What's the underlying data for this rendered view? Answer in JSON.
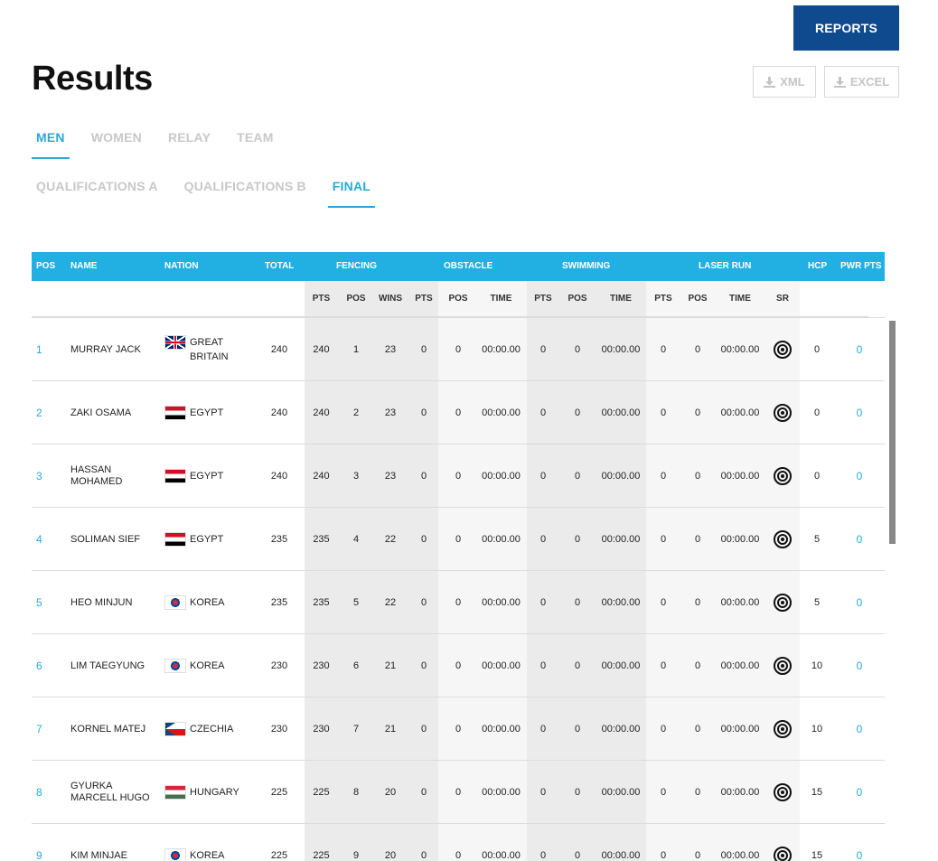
{
  "reports_label": "REPORTS",
  "title": "Results",
  "downloads": {
    "xml": "XML",
    "excel": "EXCEL"
  },
  "gender_tabs": [
    {
      "label": "MEN",
      "active": true
    },
    {
      "label": "WOMEN",
      "active": false
    },
    {
      "label": "RELAY",
      "active": false
    },
    {
      "label": "TEAM",
      "active": false
    }
  ],
  "round_tabs": [
    {
      "label": "QUALIFICATIONS A",
      "active": false
    },
    {
      "label": "QUALIFICATIONS B",
      "active": false
    },
    {
      "label": "FINAL",
      "active": true
    }
  ],
  "header_top": {
    "pos": "POS",
    "name": "NAME",
    "nation": "NATION",
    "total": "TOTAL",
    "fencing": "FENCING",
    "obstacle": "OBSTACLE",
    "swimming": "SWIMMING",
    "laser_run": "LASER RUN",
    "hcp": "HCP",
    "pwr_pts": "PWR PTS"
  },
  "header_sub": {
    "fencing": [
      "PTS",
      "POS",
      "WINS"
    ],
    "obstacle": [
      "PTS",
      "POS",
      "TIME"
    ],
    "swimming": [
      "PTS",
      "POS",
      "TIME"
    ],
    "laser_run": [
      "PTS",
      "POS",
      "TIME",
      "SR"
    ]
  },
  "accent_color": "#22afe2",
  "rows": [
    {
      "pos": "1",
      "name_l1": "MURRAY JACK",
      "name_l2": "",
      "nation_l1": "GREAT",
      "nation_l2": "BRITAIN",
      "flag": "gb",
      "total": "240",
      "f_pts": "240",
      "f_pos": "1",
      "f_wins": "23",
      "o_pts": "0",
      "o_pos": "0",
      "o_time": "00:00.00",
      "s_pts": "0",
      "s_pos": "0",
      "s_time": "00:00.00",
      "l_pts": "0",
      "l_pos": "0",
      "l_time": "00:00.00",
      "sr": "target-icon",
      "hcp": "0",
      "pwr": "0"
    },
    {
      "pos": "2",
      "name_l1": "ZAKI OSAMA",
      "name_l2": "",
      "nation_l1": "EGYPT",
      "nation_l2": "",
      "flag": "eg",
      "total": "240",
      "f_pts": "240",
      "f_pos": "2",
      "f_wins": "23",
      "o_pts": "0",
      "o_pos": "0",
      "o_time": "00:00.00",
      "s_pts": "0",
      "s_pos": "0",
      "s_time": "00:00.00",
      "l_pts": "0",
      "l_pos": "0",
      "l_time": "00:00.00",
      "sr": "target-icon",
      "hcp": "0",
      "pwr": "0"
    },
    {
      "pos": "3",
      "name_l1": "HASSAN",
      "name_l2": "MOHAMED",
      "nation_l1": "EGYPT",
      "nation_l2": "",
      "flag": "eg",
      "total": "240",
      "f_pts": "240",
      "f_pos": "3",
      "f_wins": "23",
      "o_pts": "0",
      "o_pos": "0",
      "o_time": "00:00.00",
      "s_pts": "0",
      "s_pos": "0",
      "s_time": "00:00.00",
      "l_pts": "0",
      "l_pos": "0",
      "l_time": "00:00.00",
      "sr": "target-icon",
      "hcp": "0",
      "pwr": "0"
    },
    {
      "pos": "4",
      "name_l1": "SOLIMAN SIEF",
      "name_l2": "",
      "nation_l1": "EGYPT",
      "nation_l2": "",
      "flag": "eg",
      "total": "235",
      "f_pts": "235",
      "f_pos": "4",
      "f_wins": "22",
      "o_pts": "0",
      "o_pos": "0",
      "o_time": "00:00.00",
      "s_pts": "0",
      "s_pos": "0",
      "s_time": "00:00.00",
      "l_pts": "0",
      "l_pos": "0",
      "l_time": "00:00.00",
      "sr": "target-icon",
      "hcp": "5",
      "pwr": "0"
    },
    {
      "pos": "5",
      "name_l1": "HEO MINJUN",
      "name_l2": "",
      "nation_l1": "KOREA",
      "nation_l2": "",
      "flag": "kr",
      "total": "235",
      "f_pts": "235",
      "f_pos": "5",
      "f_wins": "22",
      "o_pts": "0",
      "o_pos": "0",
      "o_time": "00:00.00",
      "s_pts": "0",
      "s_pos": "0",
      "s_time": "00:00.00",
      "l_pts": "0",
      "l_pos": "0",
      "l_time": "00:00.00",
      "sr": "target-icon",
      "hcp": "5",
      "pwr": "0"
    },
    {
      "pos": "6",
      "name_l1": "LIM TAEGYUNG",
      "name_l2": "",
      "nation_l1": "KOREA",
      "nation_l2": "",
      "flag": "kr",
      "total": "230",
      "f_pts": "230",
      "f_pos": "6",
      "f_wins": "21",
      "o_pts": "0",
      "o_pos": "0",
      "o_time": "00:00.00",
      "s_pts": "0",
      "s_pos": "0",
      "s_time": "00:00.00",
      "l_pts": "0",
      "l_pos": "0",
      "l_time": "00:00.00",
      "sr": "target-icon",
      "hcp": "10",
      "pwr": "0"
    },
    {
      "pos": "7",
      "name_l1": "KORNEL MATEJ",
      "name_l2": "",
      "nation_l1": "CZECHIA",
      "nation_l2": "",
      "flag": "cz",
      "total": "230",
      "f_pts": "230",
      "f_pos": "7",
      "f_wins": "21",
      "o_pts": "0",
      "o_pos": "0",
      "o_time": "00:00.00",
      "s_pts": "0",
      "s_pos": "0",
      "s_time": "00:00.00",
      "l_pts": "0",
      "l_pos": "0",
      "l_time": "00:00.00",
      "sr": "target-icon",
      "hcp": "10",
      "pwr": "0"
    },
    {
      "pos": "8",
      "name_l1": "GYURKA",
      "name_l2": "MARCELL HUGO",
      "nation_l1": "HUNGARY",
      "nation_l2": "",
      "flag": "hu",
      "total": "225",
      "f_pts": "225",
      "f_pos": "8",
      "f_wins": "20",
      "o_pts": "0",
      "o_pos": "0",
      "o_time": "00:00.00",
      "s_pts": "0",
      "s_pos": "0",
      "s_time": "00:00.00",
      "l_pts": "0",
      "l_pos": "0",
      "l_time": "00:00.00",
      "sr": "target-icon",
      "hcp": "15",
      "pwr": "0"
    },
    {
      "pos": "9",
      "name_l1": "KIM MINJAE",
      "name_l2": "",
      "nation_l1": "KOREA",
      "nation_l2": "",
      "flag": "kr",
      "total": "225",
      "f_pts": "225",
      "f_pos": "9",
      "f_wins": "20",
      "o_pts": "0",
      "o_pos": "0",
      "o_time": "00:00.00",
      "s_pts": "0",
      "s_pos": "0",
      "s_time": "00:00.00",
      "l_pts": "0",
      "l_pos": "0",
      "l_time": "00:00.00",
      "sr": "target-icon",
      "hcp": "15",
      "pwr": "0"
    }
  ]
}
